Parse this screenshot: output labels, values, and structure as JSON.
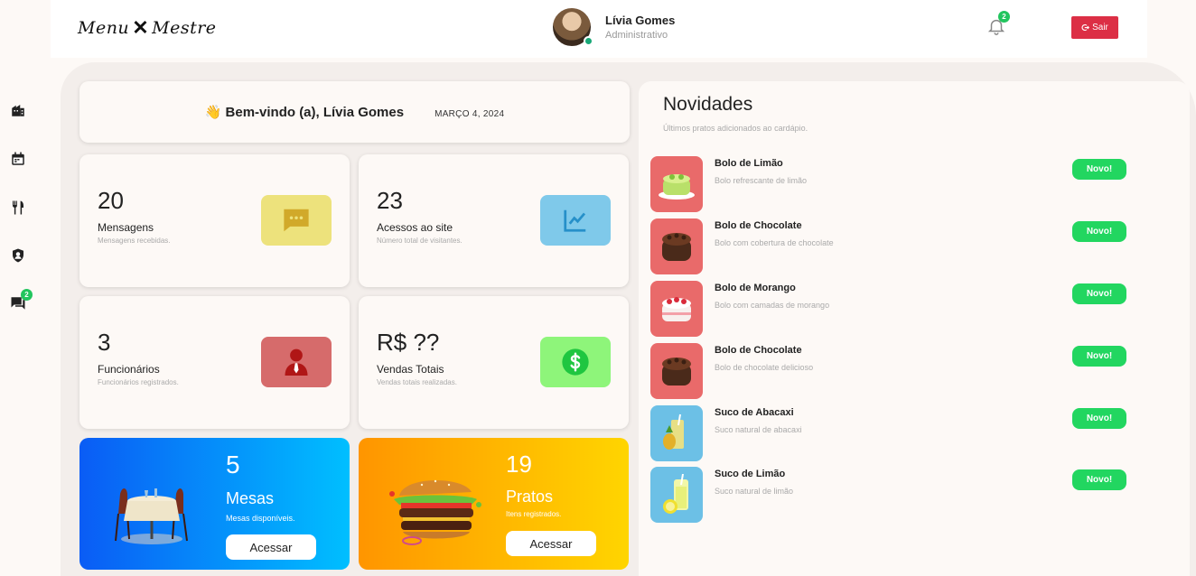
{
  "header": {
    "logo": {
      "left": "Menu",
      "right": "Mestre"
    },
    "user": {
      "name": "Lívia Gomes",
      "role": "Administrativo"
    },
    "notifications_count": "2",
    "logout_label": "Sair"
  },
  "sidebar": {
    "items": [
      {
        "name": "building",
        "icon": "building-icon"
      },
      {
        "name": "calendar",
        "icon": "calendar-icon"
      },
      {
        "name": "cutlery",
        "icon": "cutlery-icon"
      },
      {
        "name": "user-badge",
        "icon": "user-badge-icon"
      },
      {
        "name": "messages",
        "icon": "chat-icon",
        "badge": "2"
      }
    ]
  },
  "welcome": {
    "emoji": "👋",
    "title": "Bem-vindo (a), Lívia Gomes",
    "date": "MARÇO 4, 2024"
  },
  "stats": [
    {
      "value": "20",
      "label": "Mensagens",
      "sub": "Mensagens recebidas.",
      "icon": "chat-dots-icon",
      "color": "#ede27c",
      "icon_color": "#d1a92a"
    },
    {
      "value": "23",
      "label": "Acessos ao site",
      "sub": "Número total de visitantes.",
      "icon": "line-chart-icon",
      "color": "#7fc9ea",
      "icon_color": "#2690c9"
    },
    {
      "value": "3",
      "label": "Funcionários",
      "sub": "Funcionários registrados.",
      "icon": "employee-icon",
      "color": "#d66b6b",
      "icon_color": "#b01616"
    },
    {
      "value": "R$ ??",
      "label": "Vendas Totais",
      "sub": "Vendas totais realizadas.",
      "icon": "dollar-icon",
      "color": "#8ef57a",
      "icon_color": "#1fc640"
    }
  ],
  "promos": {
    "tables": {
      "value": "5",
      "label": "Mesas",
      "sub": "Mesas disponíveis.",
      "button": "Acessar"
    },
    "dishes": {
      "value": "19",
      "label": "Pratos",
      "sub": "Itens registrados.",
      "button": "Acessar"
    }
  },
  "news": {
    "title": "Novidades",
    "subtitle": "Últimos pratos adicionados ao cardápio.",
    "items": [
      {
        "name": "Bolo de Limão",
        "desc": "Bolo refrescante de limão",
        "badge": "Novo!",
        "thumb_color": "#e96a6a",
        "image": "lime-cake"
      },
      {
        "name": "Bolo de Chocolate",
        "desc": "Bolo com cobertura de chocolate",
        "badge": "Novo!",
        "thumb_color": "#e96a6a",
        "image": "chocolate-cake"
      },
      {
        "name": "Bolo de Morango",
        "desc": "Bolo com camadas de morango",
        "badge": "Novo!",
        "thumb_color": "#e96a6a",
        "image": "strawberry-cake"
      },
      {
        "name": "Bolo de Chocolate",
        "desc": "Bolo de chocolate delicioso",
        "badge": "Novo!",
        "thumb_color": "#e96a6a",
        "image": "chocolate-cake"
      },
      {
        "name": "Suco de Abacaxi",
        "desc": "Suco natural de abacaxi",
        "badge": "Novo!",
        "thumb_color": "#6cc0e6",
        "image": "pineapple-juice"
      },
      {
        "name": "Suco de Limão",
        "desc": "Suco natural de limão",
        "badge": "Novo!",
        "thumb_color": "#6cc0e6",
        "image": "lemon-juice"
      }
    ]
  }
}
